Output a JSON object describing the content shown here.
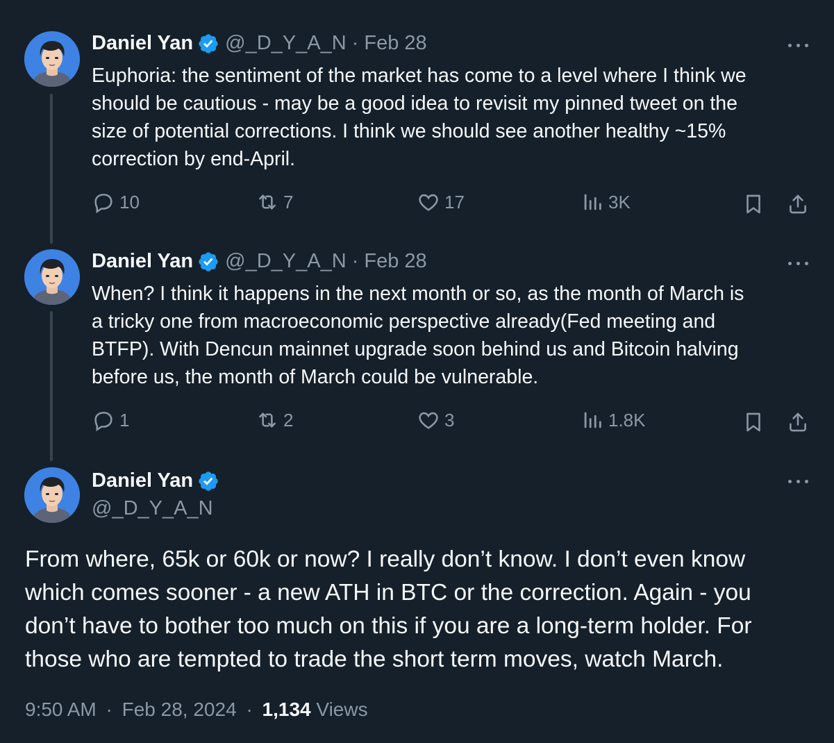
{
  "author": {
    "name": "Daniel Yan",
    "handle": "@_D_Y_A_N"
  },
  "tweets": [
    {
      "date": "Feb 28",
      "text": "Euphoria: the sentiment of the market has come to a level where I think we\nshould be cautious - may be a good idea to revisit my pinned tweet on the\nsize of potential corrections. I think we should see another healthy ~15%\ncorrection by end-April.",
      "replies": "10",
      "reposts": "7",
      "likes": "17",
      "views": "3K"
    },
    {
      "date": "Feb 28",
      "text": "When? I think it happens in the next month or so, as the month of March is\na tricky one from macroeconomic perspective already(Fed meeting and\nBTFP). With Dencun mainnet upgrade soon behind us and Bitcoin halving\nbefore us, the month of March could be vulnerable.",
      "replies": "1",
      "reposts": "2",
      "likes": "3",
      "views": "1.8K"
    }
  ],
  "main_tweet": {
    "text": "From where, 65k or 60k or now? I really don’t know. I don’t even know\nwhich comes sooner - a new ATH in BTC or the correction. Again - you\ndon’t have to bother too much on this if you are a long-term holder. For\nthose who are tempted to trade the short term moves, watch March.",
    "time": "9:50 AM",
    "date": "Feb 28, 2024",
    "views_count": "1,134",
    "views_label": "Views"
  },
  "separator": "·",
  "icons": [
    "reply-icon",
    "repost-icon",
    "like-icon",
    "views-icon",
    "bookmark-icon",
    "share-icon",
    "verified-icon",
    "more-icon"
  ],
  "colors": {
    "background": "#15202b",
    "text": "#f7f9f9",
    "muted": "#8b98a5",
    "verified": "#1d9bf0",
    "thread_line": "#38444d"
  }
}
